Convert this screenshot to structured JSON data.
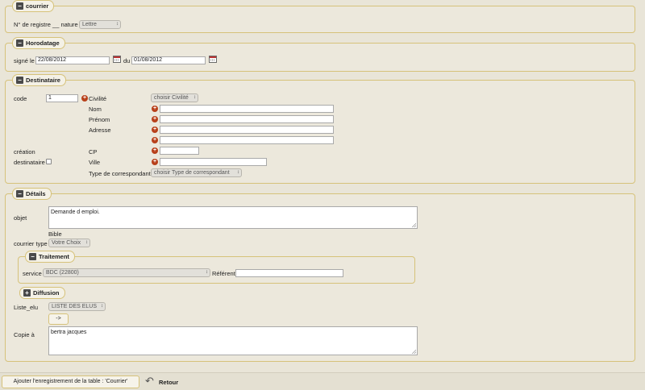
{
  "courrier": {
    "legend": "courrier",
    "registre_label": "N° de registre __ nature",
    "nature_value": "Lettre"
  },
  "horodatage": {
    "legend": "Horodatage",
    "signe_label": "signé le",
    "signe_value": "22/08/2012",
    "du_label": "du",
    "du_value": "01/08/2012"
  },
  "destinataire": {
    "legend": "Destinataire",
    "code_label": "code",
    "code_value": "1",
    "civilite_label": "Civilité",
    "civilite_value": "choisir Civilité",
    "nom_label": "Nom",
    "prenom_label": "Prénom",
    "adresse_label": "Adresse",
    "creation_label": "création",
    "destinataire_label": "destinataire",
    "cp_label": "CP",
    "ville_label": "Ville",
    "type_label": "Type de correspondant",
    "type_value": "choisir Type de correspondant"
  },
  "details": {
    "legend": "Détails",
    "objet_label": "objet",
    "objet_value": "Demande d emploi.",
    "bible_label": "Bible",
    "courrier_type_label": "courrier type",
    "courrier_type_value": "Votre Choix"
  },
  "traitement": {
    "legend": "Traitement",
    "service_label": "service",
    "service_value": "BDC (22800)",
    "referent_label": "Référent"
  },
  "diffusion": {
    "legend": "Diffusion",
    "liste_label": "Liste_elu",
    "liste_value": "LISTE DES ELUS",
    "arrow_label": "->",
    "copie_label": "Copie à",
    "copie_value": "bertra jacques"
  },
  "footer": {
    "add_label": "Ajouter l'enregistrement de la table : 'Courrier'",
    "retour_label": "Retour"
  },
  "icons": {
    "collapse": "minus-box-icon",
    "expand": "plus-box-icon",
    "calendar": "calendar-icon",
    "add": "add-circle-icon",
    "back": "back-arrow-icon"
  }
}
